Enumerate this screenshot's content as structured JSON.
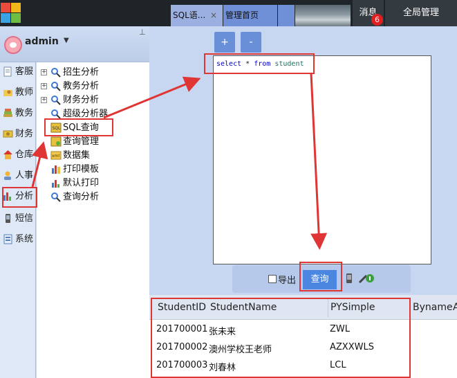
{
  "colors": {
    "accent_blue": "#6a8fd9",
    "annotation_red": "#e03535",
    "topbar": "#1f2428"
  },
  "header": {
    "tabs": [
      {
        "label": "SQL语...",
        "close": "×"
      },
      {
        "label": "管理首页"
      }
    ],
    "message_label": "消息",
    "message_count": "6",
    "global_label": "全局管理"
  },
  "user": {
    "name": "admin",
    "caret": "▼",
    "pin": "⊥"
  },
  "sidebar": {
    "items": [
      {
        "label": "客服",
        "icon": "notepad-icon"
      },
      {
        "label": "教师",
        "icon": "folder-user-icon"
      },
      {
        "label": "教务",
        "icon": "book-stack-icon"
      },
      {
        "label": "财务",
        "icon": "money-icon"
      },
      {
        "label": "仓库",
        "icon": "house-icon"
      },
      {
        "label": "人事",
        "icon": "person-question-icon"
      },
      {
        "label": "分析",
        "icon": "bar-chart-icon"
      },
      {
        "label": "短信",
        "icon": "phone-icon"
      },
      {
        "label": "系统",
        "icon": "system-icon"
      }
    ]
  },
  "tree": {
    "items": [
      {
        "label": "招生分析",
        "expander": "+",
        "icon": "search-person-icon"
      },
      {
        "label": "教务分析",
        "expander": "+",
        "icon": "search-person-icon"
      },
      {
        "label": "财务分析",
        "expander": "+",
        "icon": "search-person-icon"
      },
      {
        "label": "超级分析器",
        "icon": "search-icon"
      },
      {
        "label": "SQL查询",
        "icon": "sql-icon"
      },
      {
        "label": "查询管理",
        "icon": "sql-manage-icon"
      },
      {
        "label": "数据集",
        "icon": "xml-icon"
      },
      {
        "label": "打印模板",
        "icon": "print-template-icon"
      },
      {
        "label": "默认打印",
        "icon": "print-chart-icon"
      },
      {
        "label": "查询分析",
        "icon": "search-icon"
      }
    ]
  },
  "editor": {
    "plus": "+",
    "minus": "-",
    "sql": {
      "kw1": "select",
      "star": "*",
      "kw2": "from",
      "table": "student"
    }
  },
  "toolbar": {
    "export_label": "导出",
    "query_label": "查询"
  },
  "grid": {
    "columns": [
      "StudentID",
      "StudentName",
      "PYSimple",
      "Byname",
      "A"
    ],
    "rows": [
      [
        "201700001",
        "张未来",
        "ZWL"
      ],
      [
        "201700002",
        "澳州学校王老师",
        "AZXXWLS"
      ],
      [
        "201700003",
        "刘春林",
        "LCL"
      ]
    ]
  }
}
